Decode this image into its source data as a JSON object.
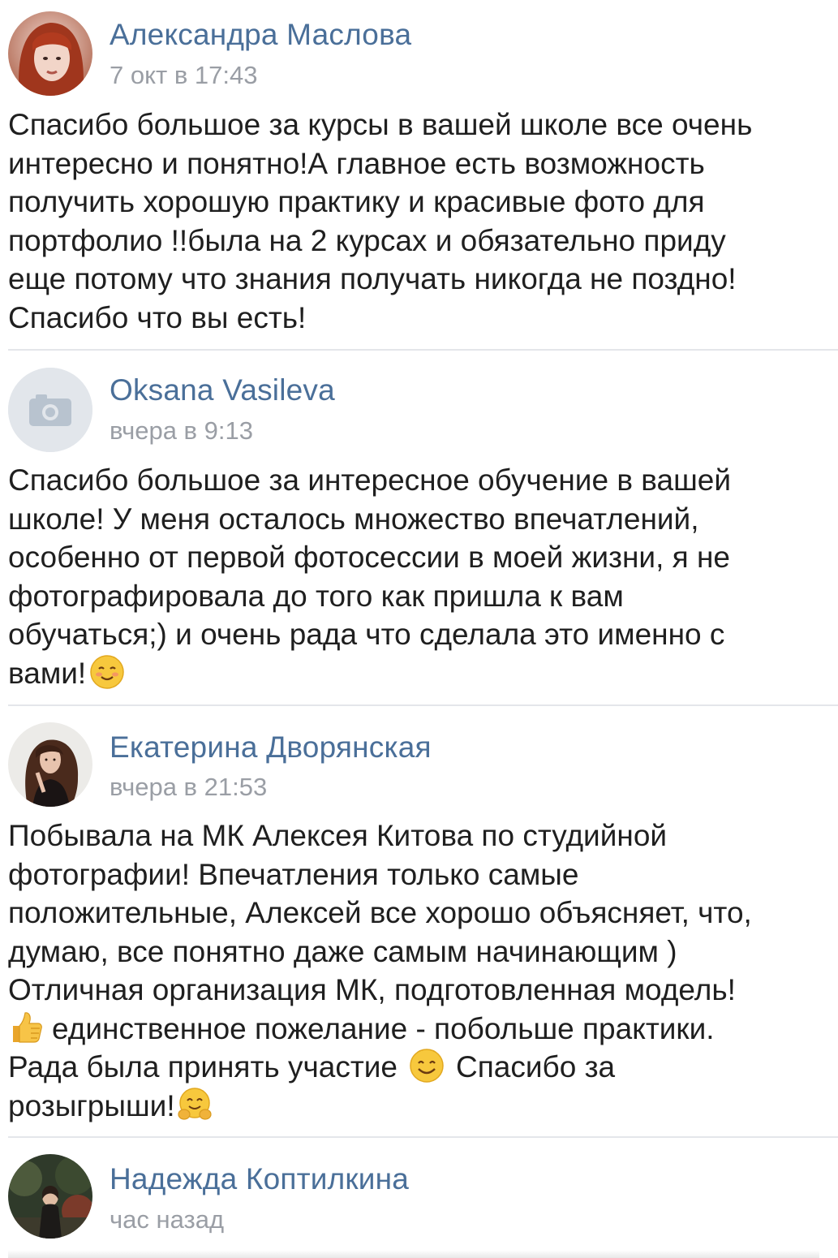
{
  "posts": [
    {
      "author": "Александра Маслова",
      "time": "7 окт в 17:43",
      "lines": [
        "Спасибо большое за курсы в вашей школе все очень",
        "интересно и понятно!А главное есть возможность",
        "получить хорошую практику и красивые фото для",
        "портфолио !!была на 2 курсах и обязательно приду",
        "еще потому что знания получать никогда не поздно!",
        "Спасибо что вы есть!"
      ]
    },
    {
      "author": "Oksana Vasileva",
      "time": "вчера в 9:13",
      "lines": [
        "Спасибо большое за интересное обучение в вашей",
        "школе! У меня осталось множество впечатлений,",
        "особенно от первой фотосессии в моей жизни, я не",
        "фотографировала до того как пришла к вам",
        "обучаться;) и очень рада что сделала это именно с",
        "вами!"
      ]
    },
    {
      "author": "Екатерина Дворянская",
      "time": "вчера в 21:53",
      "lines": [
        "Побывала на МК Алексея Китова по студийной",
        "фотографии! Впечатления только самые",
        "положительные, Алексей все хорошо объясняет, что,",
        "думаю, все понятно даже самым начинающим )",
        "Отличная организация МК, подготовленная модель!",
        "единственное пожелание - побольше практики.",
        "Рада была принять участие",
        "Спасибо за",
        "розыгрыши!"
      ]
    },
    {
      "author": "Надежда Коптилкина",
      "time": "час назад"
    }
  ],
  "icons": {
    "camera": "camera-icon",
    "blush": "smiling-blush-emoji",
    "thumbs": "thumbs-up-emoji",
    "smile": "smiling-face-emoji",
    "hug": "hugging-face-emoji"
  },
  "colors": {
    "author": "#4a6f99",
    "time": "#9a9ea5",
    "text": "#1f1f1f",
    "divider": "#e4e6ea"
  }
}
